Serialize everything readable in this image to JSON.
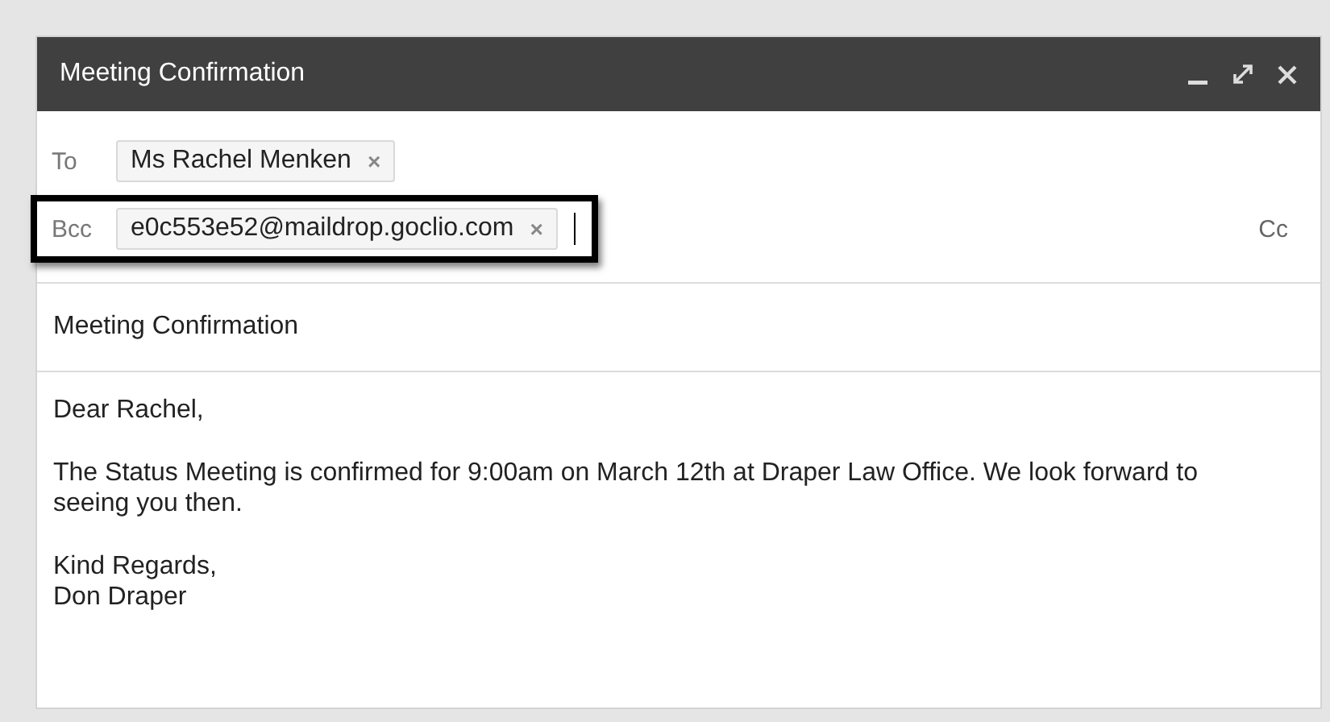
{
  "window": {
    "title": "Meeting Confirmation"
  },
  "recipients": [
    {
      "label": "To",
      "chips": [
        "Ms Rachel Menken"
      ],
      "highlighted": false,
      "focused": false
    },
    {
      "label": "Bcc",
      "chips": [
        "e0c553e52@maildrop.goclio.com"
      ],
      "highlighted": true,
      "focused": true,
      "cc_link": "Cc"
    }
  ],
  "chip_remove": "×",
  "subject": {
    "value": "Meeting Confirmation"
  },
  "body": {
    "paragraphs": [
      "Dear Rachel,",
      "The Status Meeting is confirmed for 9:00am on March 12th at Draper Law Office. We look forward to seeing you then.",
      "Kind Regards,\nDon Draper"
    ]
  }
}
